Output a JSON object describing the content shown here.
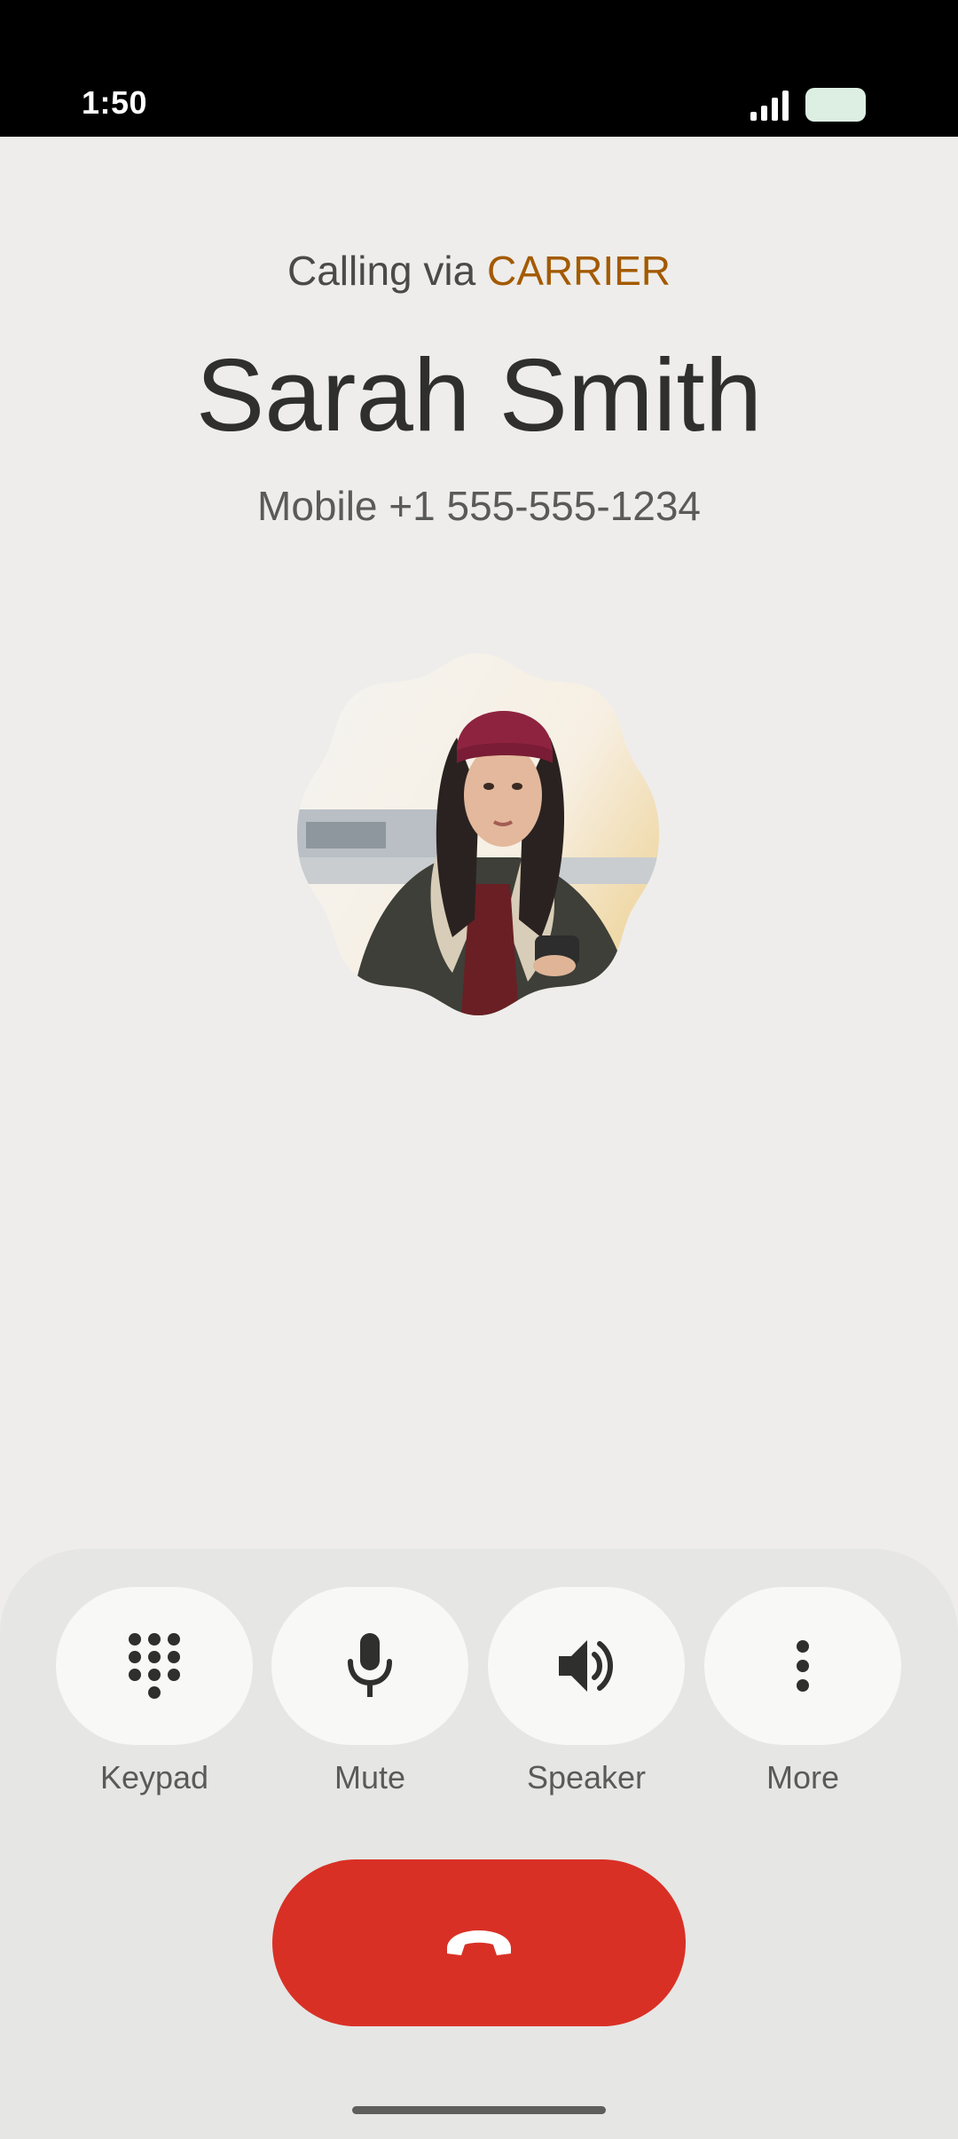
{
  "status_bar": {
    "time": "1:50",
    "signal_icon": "signal-icon",
    "battery_icon": "battery-icon"
  },
  "call": {
    "calling_via_prefix": "Calling via ",
    "carrier": "CARRIER",
    "contact_name": "Sarah Smith",
    "contact_detail": "Mobile +1 555-555-1234",
    "avatar_icon": "contact-photo"
  },
  "actions": [
    {
      "label": "Keypad",
      "icon": "dialpad-icon"
    },
    {
      "label": "Mute",
      "icon": "microphone-icon"
    },
    {
      "label": "Speaker",
      "icon": "speaker-icon"
    },
    {
      "label": "More",
      "icon": "more-vert-icon"
    }
  ],
  "end_call": {
    "icon": "call-end-icon"
  },
  "colors": {
    "background": "#eeedeb",
    "carrier_accent": "#a35a00",
    "end_call": "#d93025",
    "button_bg": "#f8f8f6",
    "sheet_bg": "#e6e6e4"
  }
}
